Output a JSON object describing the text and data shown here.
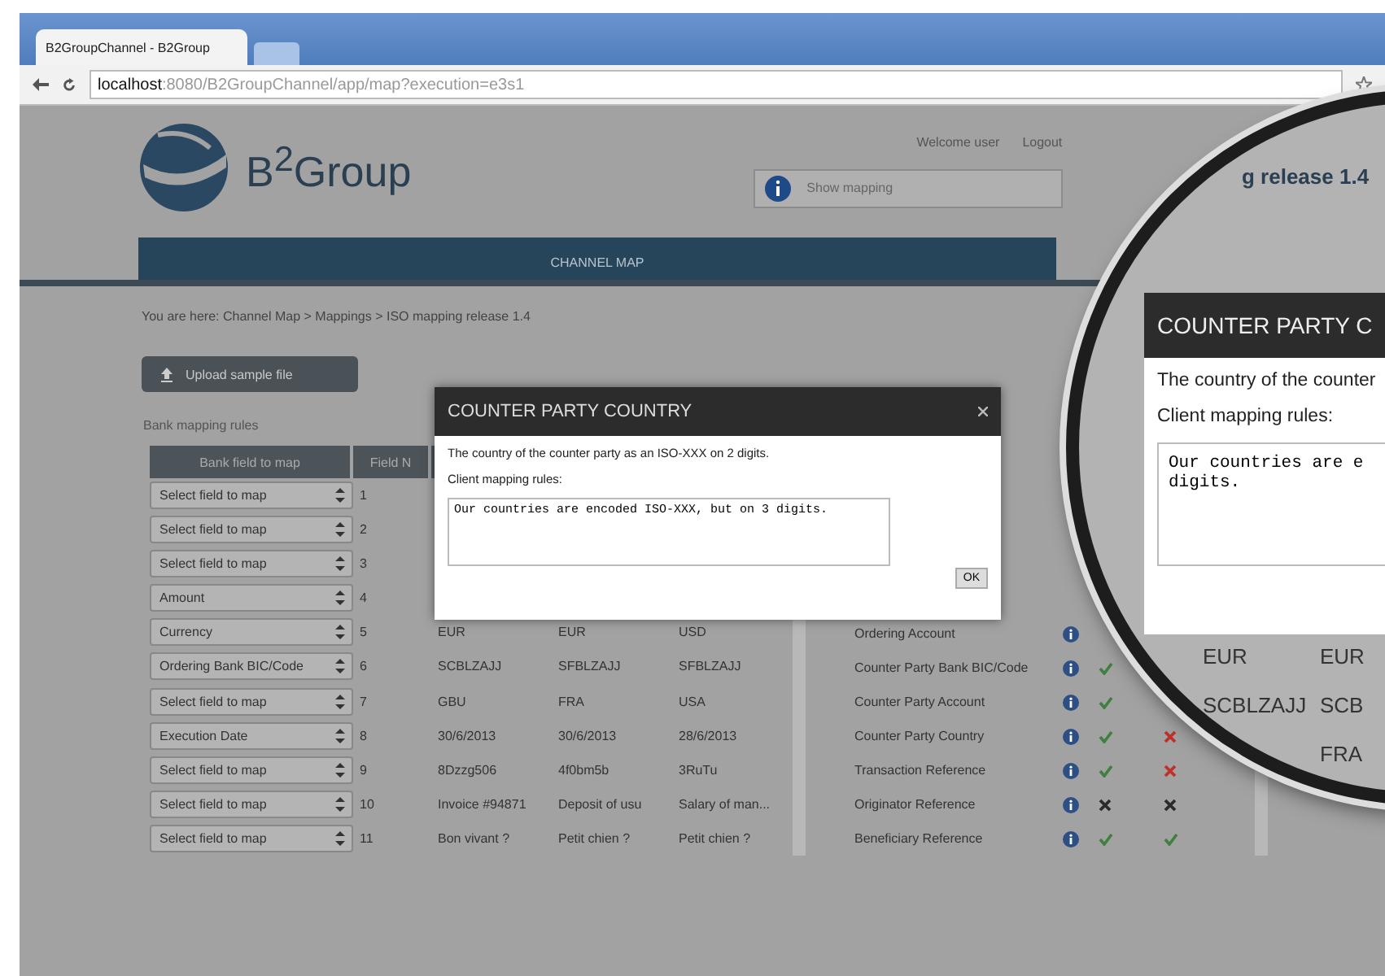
{
  "browser": {
    "tab": "B2GroupChannel - B2Group",
    "url_host": "localhost",
    "url_path": ":8080/B2GroupChannel/app/map?execution=e3s1"
  },
  "header": {
    "logo": "B$^{2}$Group",
    "user_links": [
      "Welcome user",
      "Logout"
    ],
    "search": {
      "placeholder": "Show mapping"
    }
  },
  "nav": {
    "label": "CHANNEL MAP"
  },
  "breadcrumb": "You are here: Channel Map > Mappings > ISO mapping release 1.4",
  "upload_button": "Upload sample file",
  "section_title": "Bank mapping rules",
  "bank_table": {
    "columns": [
      "Bank field to map",
      "Field N"
    ],
    "rows": [
      {
        "field": "Select field to map",
        "number": "1"
      },
      {
        "field": "Select field to map",
        "number": "2"
      },
      {
        "field": "Select field to map",
        "number": "3"
      },
      {
        "field": "Amount",
        "number": "4"
      },
      {
        "field": "Currency",
        "number": "5",
        "samples": [
          "EUR",
          "EUR",
          "USD"
        ]
      },
      {
        "field": "Ordering Bank BIC/Code",
        "number": "6",
        "samples": [
          "SCBLZAJJ",
          "SFBLZAJJ",
          "SFBLZAJJ"
        ]
      },
      {
        "field": "Select field to map",
        "number": "7",
        "samples": [
          "GBU",
          "FRA",
          "USA"
        ]
      },
      {
        "field": "Execution Date",
        "number": "8",
        "samples": [
          "30/6/2013",
          "30/6/2013",
          "28/6/2013"
        ]
      },
      {
        "field": "Select field to map",
        "number": "9",
        "samples": [
          "8Dzzg506",
          "4f0bm5b",
          "3RuTu"
        ]
      },
      {
        "field": "Select field to map",
        "number": "10",
        "samples": [
          "Invoice #94871",
          "Deposit of usu",
          "Salary of man..."
        ]
      },
      {
        "field": "Select field to map",
        "number": "11",
        "samples": [
          "Bon vivant ?",
          "Petit chien ?",
          "Petit chien ?"
        ]
      }
    ]
  },
  "client_table": {
    "rows": [
      {
        "name": "Ordering Account"
      },
      {
        "name": "Counter Party Bank BIC/Code",
        "match": {
          "kind": "check",
          "color": "#3f7f3f"
        }
      },
      {
        "name": "Counter Party Account",
        "match": {
          "kind": "check",
          "color": "#3f7f3f"
        }
      },
      {
        "name": "Counter Party Country",
        "match": {
          "kind": "check",
          "color": "#3f7f3f"
        },
        "result": {
          "kind": "cross",
          "color": "#c0302a"
        }
      },
      {
        "name": "Transaction Reference",
        "match": {
          "kind": "check",
          "color": "#3f7f3f"
        },
        "result": {
          "kind": "cross",
          "color": "#c0302a"
        }
      },
      {
        "name": "Originator Reference",
        "match": {
          "kind": "cross",
          "color": "#2a2a2a"
        },
        "result": {
          "kind": "cross",
          "color": "#2a2a2a"
        }
      },
      {
        "name": "Beneficiary Reference",
        "match": {
          "kind": "check",
          "color": "#3f7f3f"
        },
        "result": {
          "kind": "check",
          "color": "#3f7f3f"
        }
      }
    ]
  },
  "dialog": {
    "title": "COUNTER PARTY COUNTRY",
    "description": "The country of the counter party as an ISO-XXX on 2 digits.",
    "rules_label": "Client mapping rules:",
    "rules_text": "Our countries are encoded ISO-XXX, but on 3 digits.",
    "ok_button": "OK"
  },
  "magnifier": {
    "page_title": "g release 1.4",
    "dialog_title": "COUNTER PARTY C",
    "description": "The country of the counter",
    "rules_label": "Client mapping rules:",
    "rules_lines": [
      "Our countries are e",
      "digits."
    ],
    "rows": [
      {
        "col_1": "EUR",
        "col_2": "EUR"
      },
      {
        "col_1": "SCBLZAJJ",
        "col_2": "SCB"
      },
      {
        "col_2": "FRA"
      }
    ]
  }
}
